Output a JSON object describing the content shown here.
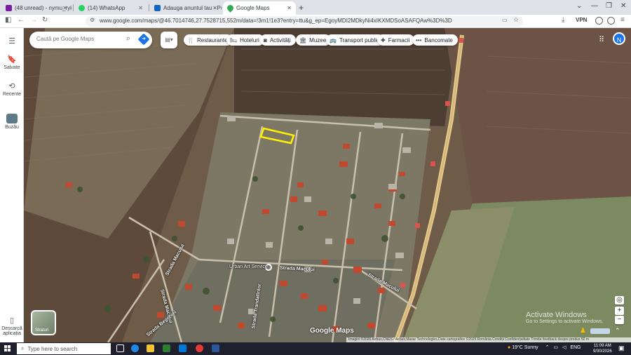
{
  "browser": {
    "tabs": [
      {
        "title": "(48 unread) - nymu_ryk2002@y",
        "active": false,
        "favicon_color": "#7b1fa2"
      },
      {
        "title": "(14) WhatsApp",
        "active": false,
        "favicon_color": "#25d366"
      },
      {
        "title": "Adauga anuntul tau - Publi24",
        "active": false,
        "favicon_color": "#1565c0"
      },
      {
        "title": "Google Maps",
        "active": true,
        "favicon_color": "#34a853"
      }
    ],
    "new_tab": "+",
    "url": "www.google.com/maps/@46.7014746,27.7528715,552m/data=!3m1!1e3?entry=ttu&g_ep=EgoyMDI2MDkyNi4xIKXMDSoASAFQAw%3D%3D",
    "vpn_label": "VPN"
  },
  "rail": {
    "menu_icon": "menu-icon",
    "items": [
      {
        "label": "Salvate",
        "icon": "bookmark-icon"
      },
      {
        "label": "Recente",
        "icon": "history-icon"
      },
      {
        "label": "Buzău",
        "icon": "place-thumbnail-icon"
      },
      {
        "label": "Descarcă aplicația",
        "icon": "phone-icon"
      }
    ]
  },
  "search": {
    "placeholder": "Caută pe Google Maps"
  },
  "chips": [
    {
      "label": "Restaurante",
      "icon": "restaurant-icon"
    },
    {
      "label": "Hoteluri",
      "icon": "hotel-icon"
    },
    {
      "label": "Activități",
      "icon": "camera-icon"
    },
    {
      "label": "Muzee",
      "icon": "museum-icon"
    },
    {
      "label": "Transport public",
      "icon": "bus-icon"
    },
    {
      "label": "Farmacii",
      "icon": "pharmacy-icon"
    },
    {
      "label": "Bancomate",
      "icon": "atm-icon"
    }
  ],
  "account_initial": "N",
  "map": {
    "labels": {
      "strada_macului_1": "Strada Macului",
      "strada_macului_2": "Strada Macului",
      "strada_macului_3": "Strada Macului",
      "strada_macului_4": "Strada Macului",
      "strada_begoniei": "Strada Begoniei",
      "strada_trandafirilor": "Strada Trandafirilor",
      "service": "Urban Art Service"
    },
    "layers_label": "Straturi",
    "logo": "Google Maps",
    "attribution": "Imagini ©2026 Airbus,CNES / Airbus,Maxar Technologies,Date cartografice ©2026   România   Condiții   Confidențialitate   Trimite feedback despre produs   50 m",
    "activate_title": "Activate Windows",
    "activate_sub": "Go to Settings to activate Windows."
  },
  "taskbar": {
    "search_placeholder": "Type here to search",
    "weather": "19°C  Sunny",
    "lang": "ENG",
    "time": "11:09 AM",
    "date": "9/30/2026"
  }
}
